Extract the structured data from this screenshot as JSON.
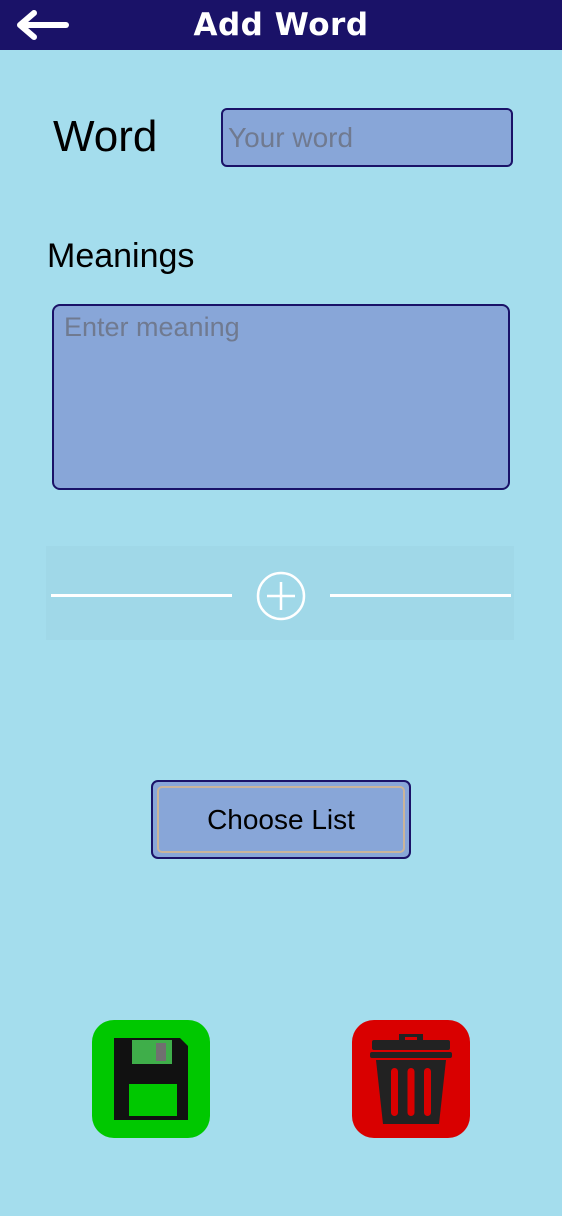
{
  "header": {
    "title": "Add Word",
    "back_icon": "arrow-left-icon"
  },
  "form": {
    "word_label": "Word",
    "word_placeholder": "Your word",
    "word_value": "",
    "meanings_label": "Meanings",
    "meaning_placeholder": "Enter meaning",
    "meaning_value": "",
    "add_meaning_icon": "plus-circle-icon"
  },
  "actions": {
    "choose_list_label": "Choose List",
    "save_icon": "floppy-disk-icon",
    "delete_icon": "trash-icon"
  },
  "colors": {
    "background": "#a4dded",
    "header": "#1a1268",
    "input_fill": "#88a6d8",
    "save_green": "#00c800",
    "delete_red": "#d90000"
  }
}
